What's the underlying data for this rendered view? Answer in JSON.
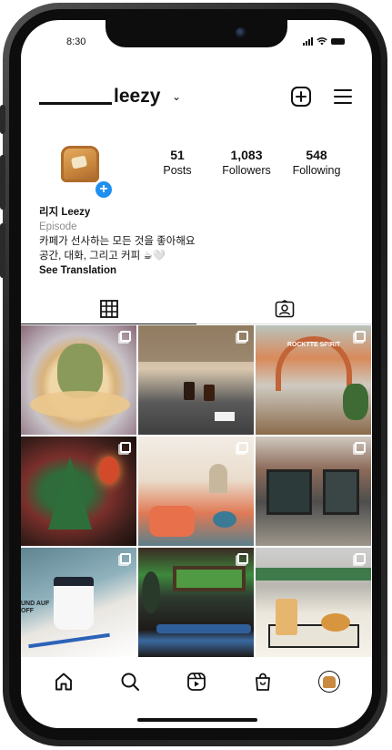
{
  "status_bar": {
    "time": "8:30"
  },
  "header": {
    "username": "leezy",
    "chevron": "⌄"
  },
  "profile": {
    "badge": "+",
    "stats": [
      {
        "value": "51",
        "label": "Posts"
      },
      {
        "value": "1,083",
        "label": "Followers"
      },
      {
        "value": "548",
        "label": "Following"
      }
    ],
    "name": "리지 Leezy",
    "category": "Episode",
    "bio_line1": "카페가 선사하는 모든 것을 좋아해요",
    "bio_line2": "공간, 대화, 그리고 커피 ☕🤍",
    "see_translation": "See Translation"
  },
  "tabs": [
    {
      "icon": "grid-icon",
      "active": true
    },
    {
      "icon": "tagged-icon",
      "active": false
    }
  ],
  "grid": {
    "posts": [
      {
        "scene": "dessert-plate",
        "multi": true
      },
      {
        "scene": "cafe-table-drinks",
        "multi": true
      },
      {
        "scene": "rockyte-spirit-storefront",
        "multi": true,
        "sign_text": "ROCKTTE SPIRIT"
      },
      {
        "scene": "christmas-tree",
        "multi": true
      },
      {
        "scene": "cafe-interior-orange-sofa",
        "multi": true
      },
      {
        "scene": "brick-cafe-exterior",
        "multi": true
      },
      {
        "scene": "coffee-cup-window",
        "multi": true,
        "cup_text": "UND AUF OFF"
      },
      {
        "scene": "window-green-view",
        "multi": true
      },
      {
        "scene": "croissant-coffee-tray",
        "multi": true
      }
    ]
  },
  "bottom_nav": [
    "home-icon",
    "search-icon",
    "reels-icon",
    "shop-icon",
    "profile-avatar"
  ],
  "colors": {
    "accent_blue": "#1f8ff0",
    "text": "#111111",
    "muted": "#8e8e8e",
    "divider": "#dbdbdb"
  }
}
